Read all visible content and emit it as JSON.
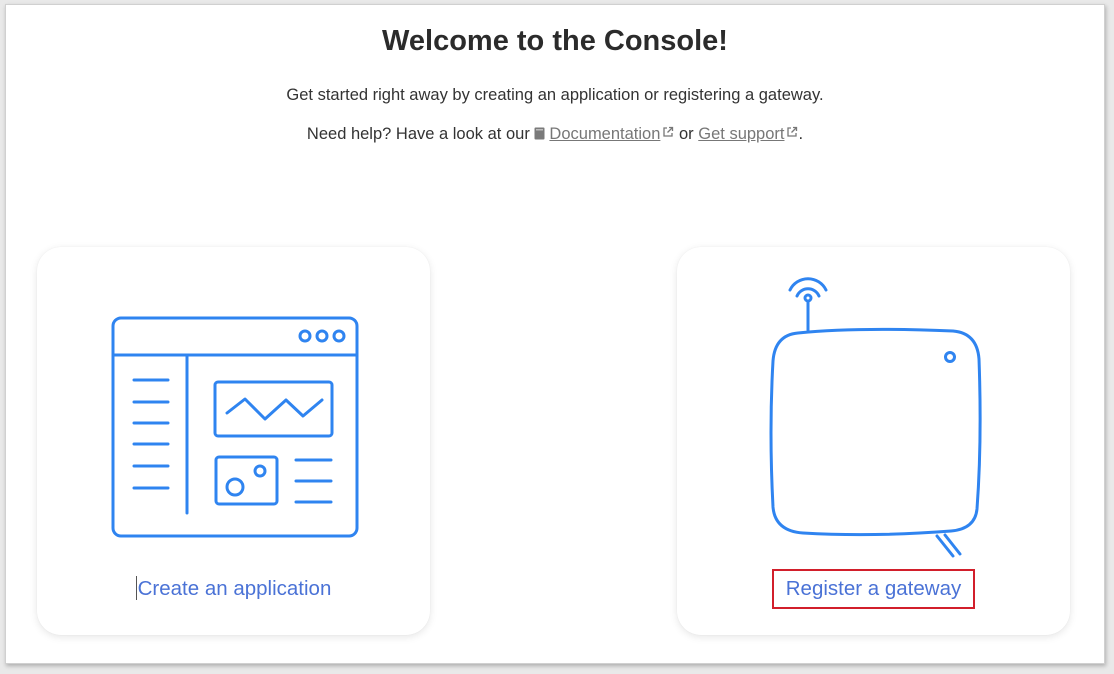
{
  "welcome": {
    "title": "Welcome to the Console!",
    "subtitle": "Get started right away by creating an application or registering a gateway.",
    "help_prefix": "Need help? Have a look at our",
    "doc_link": "Documentation",
    "or_text": "or",
    "support_link": "Get support",
    "suffix": "."
  },
  "cards": {
    "application": {
      "label": "Create an application",
      "icon": "application-window-illustration"
    },
    "gateway": {
      "label": "Register a gateway",
      "icon": "gateway-device-illustration"
    }
  },
  "colors": {
    "illustration": "#2f84f0",
    "link_text": "#4a72d6",
    "highlight_border": "#d21f2b"
  }
}
